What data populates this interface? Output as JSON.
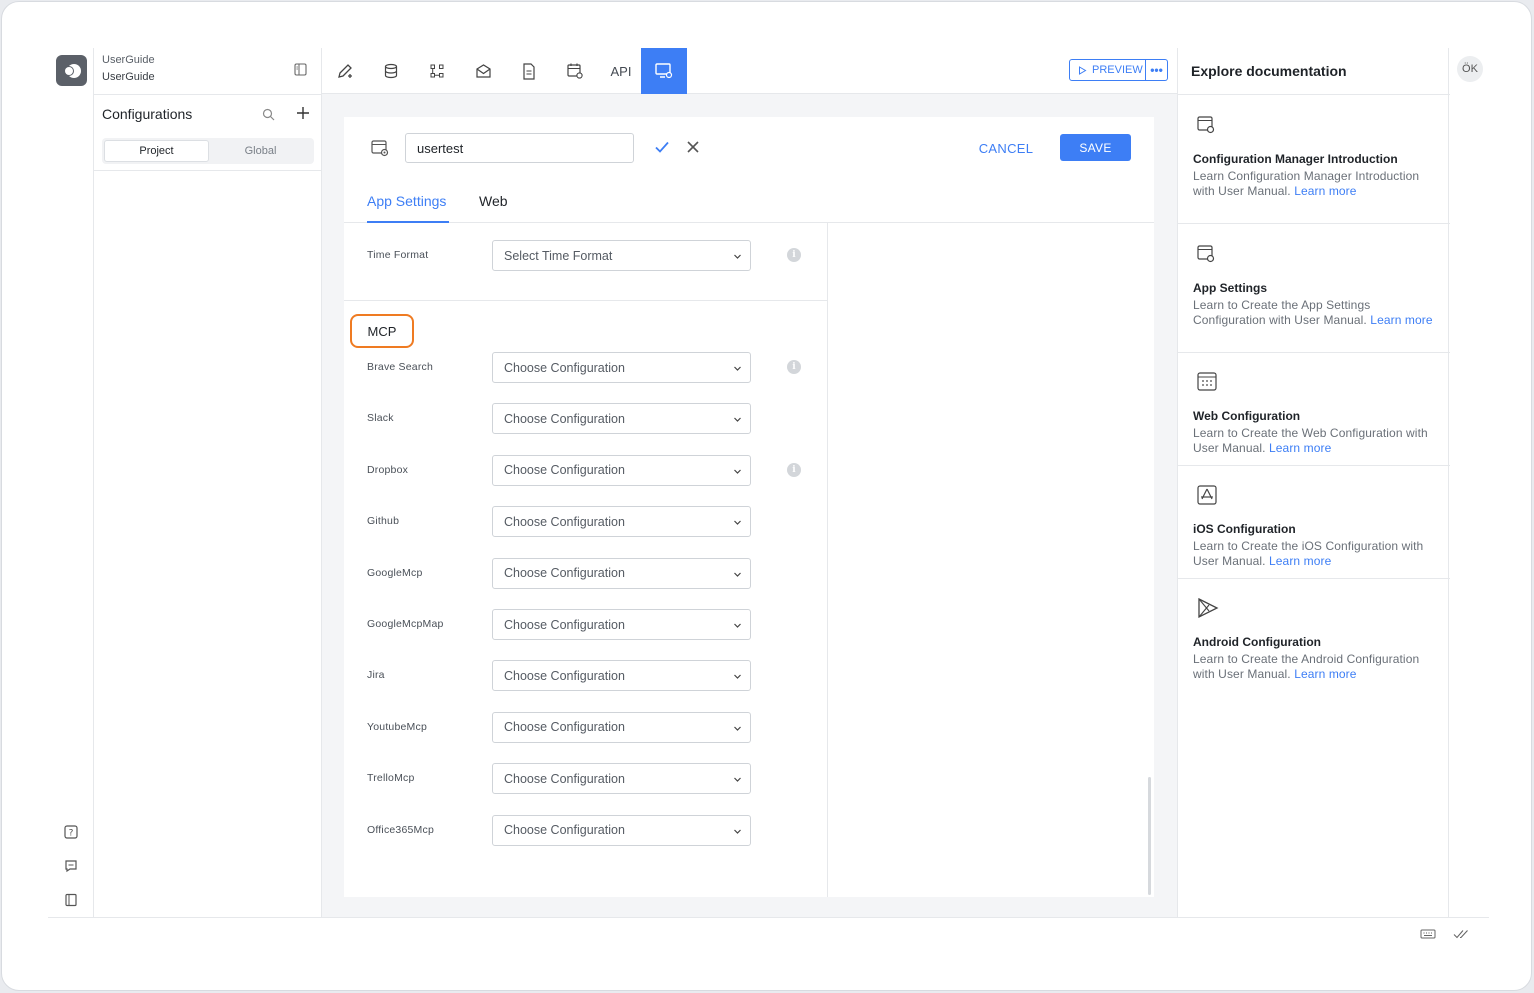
{
  "project": {
    "name": "UserGuide",
    "subtitle": "UserGuide"
  },
  "sidebar": {
    "title": "Configurations",
    "segments": [
      "Project",
      "Global"
    ],
    "active_segment": "Project"
  },
  "toolbar": {
    "api_label": "API",
    "preview_label": "PREVIEW",
    "more_label": "•••"
  },
  "editor": {
    "name_value": "usertest",
    "cancel_label": "CANCEL",
    "save_label": "SAVE",
    "tabs": [
      "App Settings",
      "Web"
    ],
    "active_tab": "App Settings",
    "time_format": {
      "label": "Time Format",
      "placeholder": "Select Time Format"
    },
    "section_title": "MCP",
    "mcp_rows": [
      {
        "label": "Brave Search",
        "value": "Choose Configuration",
        "info": true
      },
      {
        "label": "Slack",
        "value": "Choose Configuration",
        "info": false
      },
      {
        "label": "Dropbox",
        "value": "Choose Configuration",
        "info": true
      },
      {
        "label": "Github",
        "value": "Choose Configuration",
        "info": false
      },
      {
        "label": "GoogleMcp",
        "value": "Choose Configuration",
        "info": false
      },
      {
        "label": "GoogleMcpMap",
        "value": "Choose Configuration",
        "info": false
      },
      {
        "label": "Jira",
        "value": "Choose Configuration",
        "info": false
      },
      {
        "label": "YoutubeMcp",
        "value": "Choose Configuration",
        "info": false
      },
      {
        "label": "TrelloMcp",
        "value": "Choose Configuration",
        "info": false
      },
      {
        "label": "Office365Mcp",
        "value": "Choose Configuration",
        "info": false
      }
    ]
  },
  "docs": {
    "title": "Explore documentation",
    "learn_more": "Learn more",
    "items": [
      {
        "icon": "config-manager-icon",
        "title": "Configuration Manager Introduction",
        "desc": "Learn Configuration Manager Introduction with User Manual."
      },
      {
        "icon": "app-settings-icon",
        "title": "App Settings",
        "desc": "Learn to Create the App Settings Configuration with User Manual."
      },
      {
        "icon": "web-config-icon",
        "title": "Web Configuration",
        "desc": "Learn to Create the Web Configuration with User Manual."
      },
      {
        "icon": "ios-config-icon",
        "title": "iOS Configuration",
        "desc": "Learn to Create the iOS Configuration with User Manual."
      },
      {
        "icon": "android-config-icon",
        "title": "Android Configuration",
        "desc": "Learn to Create the Android Configuration with User Manual."
      }
    ]
  },
  "user": {
    "initials": "ÖK"
  },
  "colors": {
    "accent": "#3d7ef5",
    "highlight": "#ef7b22"
  }
}
